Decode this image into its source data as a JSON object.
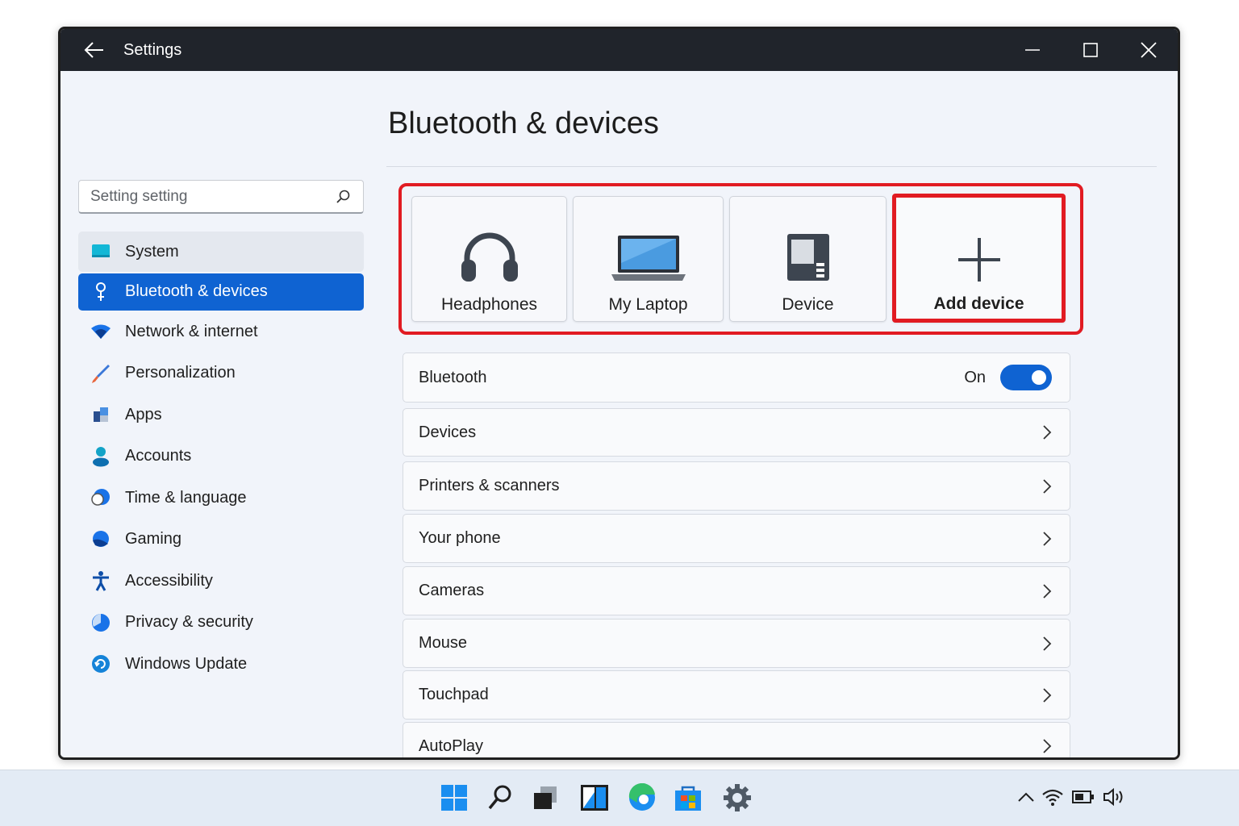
{
  "window": {
    "title": "Settings"
  },
  "sidebar": {
    "search_placeholder": "Setting setting",
    "items": [
      {
        "label": "System",
        "icon": "monitor-icon"
      },
      {
        "label": "Bluetooth & devices",
        "icon": "bluetooth-icon"
      },
      {
        "label": "Network & internet",
        "icon": "wifi-icon"
      },
      {
        "label": "Personalization",
        "icon": "brush-icon"
      },
      {
        "label": "Apps",
        "icon": "apps-icon"
      },
      {
        "label": "Accounts",
        "icon": "person-icon"
      },
      {
        "label": "Time & language",
        "icon": "globe-clock-icon"
      },
      {
        "label": "Gaming",
        "icon": "gaming-icon"
      },
      {
        "label": "Accessibility",
        "icon": "accessibility-icon"
      },
      {
        "label": "Privacy & security",
        "icon": "shield-icon"
      },
      {
        "label": "Windows Update",
        "icon": "update-icon"
      }
    ],
    "active_index": 1
  },
  "main": {
    "title": "Bluetooth & devices",
    "devices": [
      {
        "label": "Headphones",
        "icon": "headphones-icon"
      },
      {
        "label": "My Laptop",
        "icon": "laptop-icon"
      },
      {
        "label": "Device",
        "icon": "device-icon"
      },
      {
        "label": "Add device",
        "icon": "plus-icon"
      }
    ],
    "bluetooth": {
      "label": "Bluetooth",
      "state": "On",
      "enabled": true
    },
    "rows": [
      {
        "label": "Devices"
      },
      {
        "label": "Printers & scanners"
      },
      {
        "label": "Your phone"
      },
      {
        "label": "Cameras"
      },
      {
        "label": "Mouse"
      },
      {
        "label": "Touchpad"
      },
      {
        "label": "AutoPlay"
      }
    ]
  },
  "colors": {
    "accent": "#0f63d2",
    "highlight": "#e11b22",
    "titlebar": "#20242b"
  },
  "taskbar": {
    "apps": [
      "start-icon",
      "search-icon",
      "task-view-icon",
      "widgets-icon",
      "edge-icon",
      "store-icon",
      "settings-gear-icon"
    ],
    "tray": [
      "chevron-up-icon",
      "wifi-icon",
      "battery-icon",
      "volume-icon"
    ]
  }
}
